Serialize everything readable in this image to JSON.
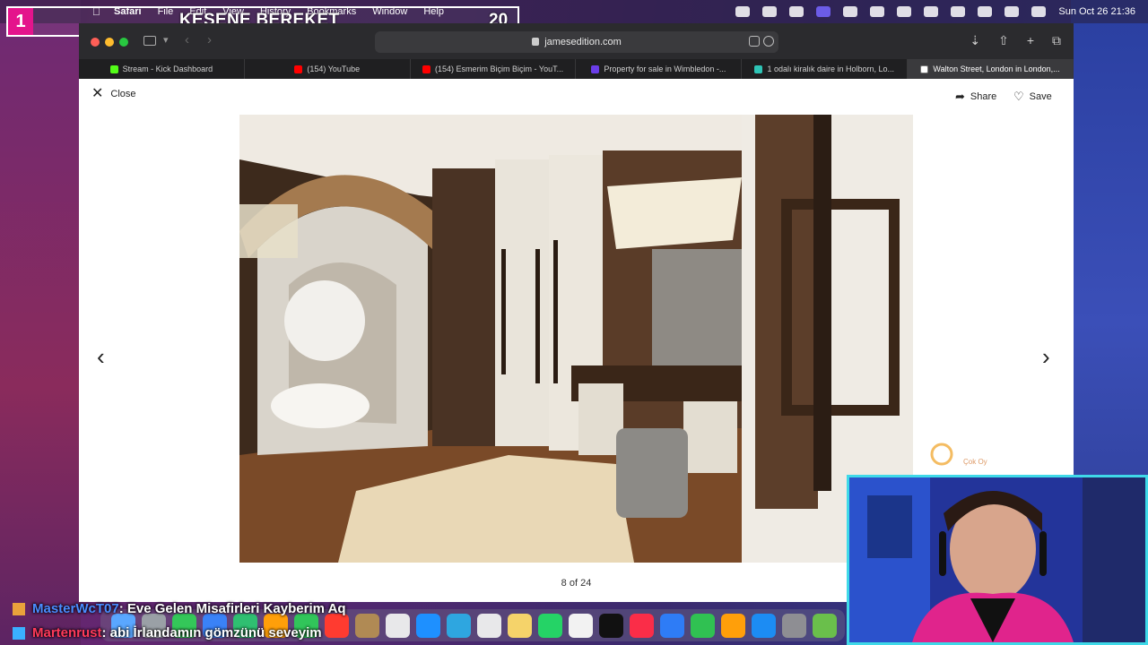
{
  "menubar": {
    "apple_icon": "apple-icon",
    "app_name": "Safari",
    "items": [
      "File",
      "Edit",
      "View",
      "History",
      "Bookmarks",
      "Window",
      "Help"
    ],
    "datetime": "Sun Oct 26  21:36"
  },
  "stream_overlay": {
    "number": "1",
    "title": "KESENE BEREKET",
    "count": "20"
  },
  "browser": {
    "url": "jamesedition.com",
    "tabs": [
      {
        "label": "Stream - Kick Dashboard",
        "color": "#53fc18"
      },
      {
        "label": "(154) YouTube",
        "color": "#ff0000"
      },
      {
        "label": "(154) Esmerim Biçim Biçim - YouT...",
        "color": "#ff0000"
      },
      {
        "label": "Property for sale in Wimbledon -...",
        "color": "#6a3de8"
      },
      {
        "label": "1 odalı kiralık daire in Holborn, Lo...",
        "color": "#2ec4b6"
      },
      {
        "label": "Walton Street, London in London,...",
        "color": "#ffffff",
        "active": true
      }
    ]
  },
  "gallery": {
    "close_label": "Close",
    "share_label": "Share",
    "save_label": "Save",
    "counter": "8 of 24",
    "prev_icon": "chevron-left-icon",
    "next_icon": "chevron-right-icon"
  },
  "chat": [
    {
      "user": "MasterWcT07",
      "message": ": Eve Gelen Misafirleri Kayberim Aq"
    },
    {
      "user": "Martenrust",
      "message": ": abi İrlandamın gömzünü seveyim"
    }
  ],
  "watermark": {
    "text": "Çok Oy"
  }
}
